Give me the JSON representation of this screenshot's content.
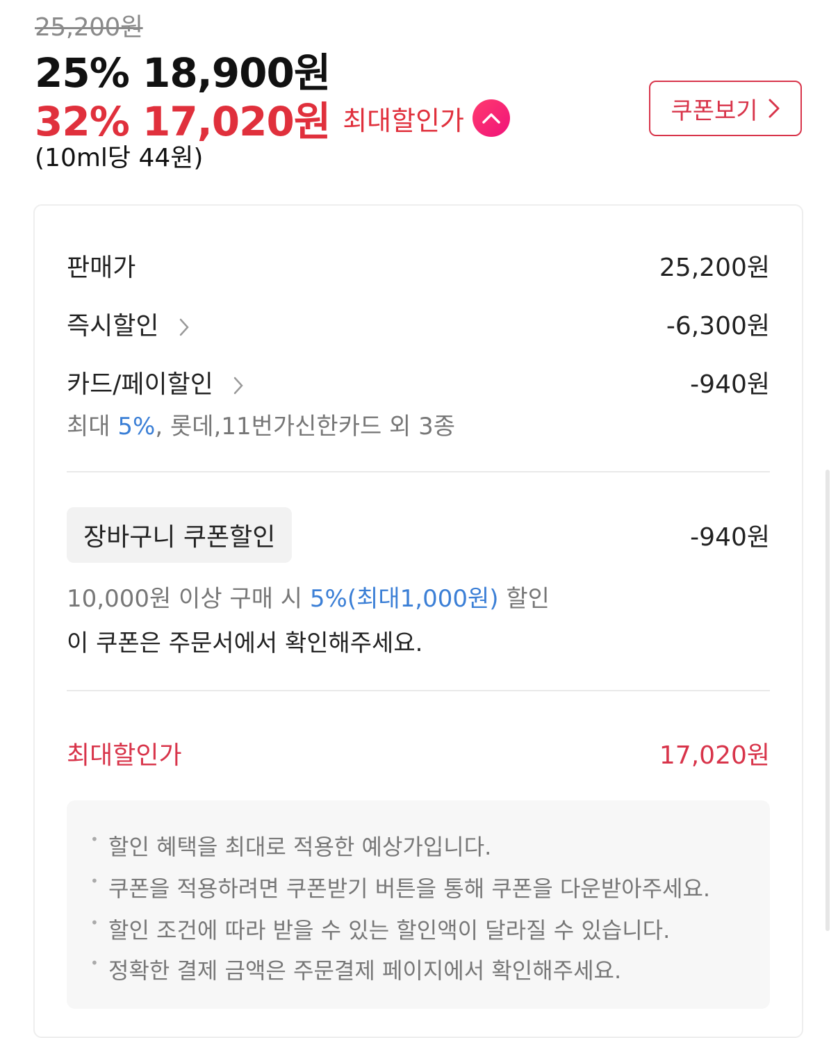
{
  "price": {
    "original": "25,200원",
    "sale_line": "25% 18,900원",
    "max_discount_pct_price": "32% 17,020원",
    "max_discount_label": "최대할인가",
    "unit_price": "(10ml당 44원)",
    "coupon_button": "쿠폰보기"
  },
  "breakdown": {
    "sale_price_label": "판매가",
    "sale_price_value": "25,200원",
    "instant_label": "즉시할인",
    "instant_value": "-6,300원",
    "card_label": "카드/페이할인",
    "card_value": "-940원",
    "card_sub_prefix": "최대 ",
    "card_sub_pct": "5%",
    "card_sub_suffix": ", 롯데,11번가신한카드 외 3종",
    "cart_coupon_label": "장바구니 쿠폰할인",
    "cart_coupon_value": "-940원",
    "cart_cond_prefix": "10,000원 이상 구매 시 ",
    "cart_cond_highlight": "5%(최대1,000원)",
    "cart_cond_suffix": " 할인",
    "cart_note": "이 쿠폰은 주문서에서 확인해주세요.",
    "max_label": "최대할인가",
    "max_value": "17,020원"
  },
  "notes": [
    "할인 혜택을 최대로 적용한 예상가입니다.",
    "쿠폰을 적용하려면 쿠폰받기 버튼을 통해 쿠폰을 다운받아주세요.",
    "할인 조건에 따라 받을 수 있는 할인액이 달라질 수 있습니다.",
    "정확한 결제 금액은 주문결제 페이지에서 확인해주세요."
  ],
  "colors": {
    "accent_red": "#e0303c",
    "link_blue": "#3b7fd6",
    "text_gray": "#777777"
  }
}
